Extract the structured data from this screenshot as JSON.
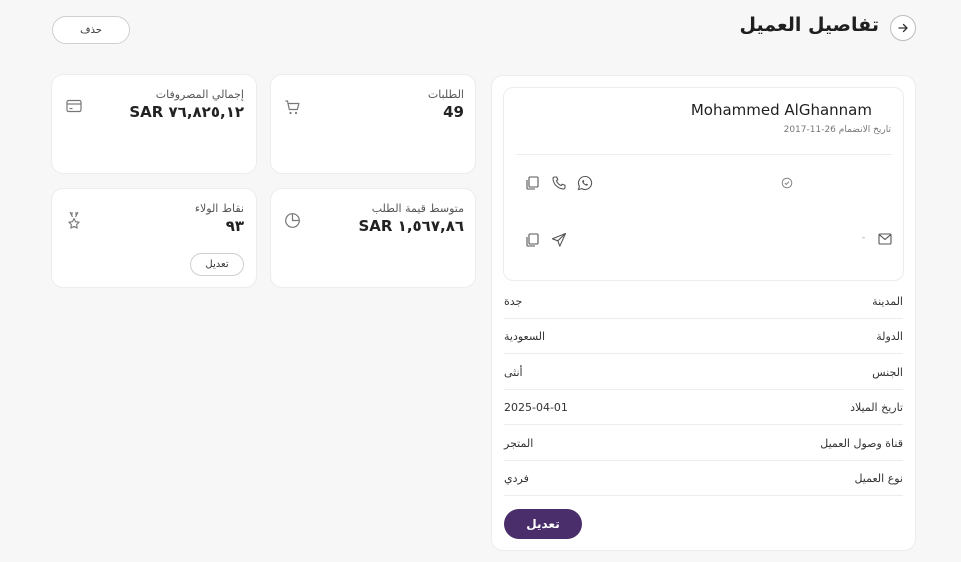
{
  "header": {
    "title": "تفاصيل العميل",
    "delete_label": "حذف"
  },
  "customer": {
    "name": "Mohammed AlGhannam",
    "join_date": "تاريخ الانضمام 26-11-2017",
    "email_value": "-"
  },
  "stats": {
    "orders_label": "الطلبات",
    "orders_value": "49",
    "spend_label": "إجمالي المصروفات",
    "spend_value": "SAR ٧٦,٨٢٥,١٢",
    "avg_label": "متوسط قيمة الطلب",
    "avg_value": "SAR ١,٥٦٧,٨٦",
    "loyalty_label": "نقاط الولاء",
    "loyalty_value": "٩٣",
    "loyalty_edit_label": "تعديل"
  },
  "details": [
    {
      "label": "المدينة",
      "value": "جدة"
    },
    {
      "label": "الدولة",
      "value": "السعودية"
    },
    {
      "label": "الجنس",
      "value": "أنثى"
    },
    {
      "label": "تاريخ الميلاد",
      "value": "2025-04-01"
    },
    {
      "label": "قناة وصول العميل",
      "value": "المتجر"
    },
    {
      "label": "نوع العميل",
      "value": "فردي"
    }
  ],
  "actions": {
    "edit_label": "تعديل"
  },
  "colors": {
    "primary": "#4a2d6b",
    "background": "#f7f7f7",
    "card": "#ffffff"
  }
}
